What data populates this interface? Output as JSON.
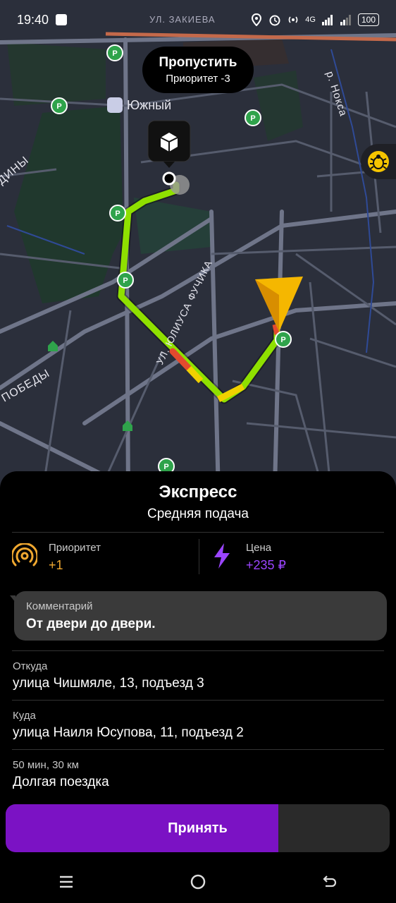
{
  "status_bar": {
    "time": "19:40",
    "battery": "100",
    "network": "4G"
  },
  "map": {
    "street_top": "УЛ. ЗАКИЕВА",
    "street_fuchika": "УЛ. ЮЛИУСА ФУЧИКА",
    "street_pobedy": "ПОБЕДЫ",
    "street_diny": "ДИНЫ",
    "river_noksa": "р. Нокса",
    "district_label": "Южный",
    "route_color": "#8fe000",
    "marker_color": "#f5b700"
  },
  "skip": {
    "title": "Пропустить",
    "subtitle": "Приоритет -3"
  },
  "order": {
    "title": "Экспресс",
    "subtitle": "Средняя подача",
    "priority_label": "Приоритет",
    "priority_value": "+1",
    "price_label": "Цена",
    "price_value": "+235 ₽",
    "priority_color": "#f0a830",
    "price_color": "#9b45ff"
  },
  "comment": {
    "label": "Комментарий",
    "text": "От двери до двери."
  },
  "route": {
    "from_label": "Откуда",
    "from_value": "улица Чишмяле, 13, подъезд 3",
    "to_label": "Куда",
    "to_value": "улица Наиля Юсупова, 11, подъезд 2",
    "trip_label": "50 мин, 30 км",
    "trip_value": "Долгая поездка"
  },
  "accept": {
    "label": "Принять",
    "progress": 0.71
  }
}
